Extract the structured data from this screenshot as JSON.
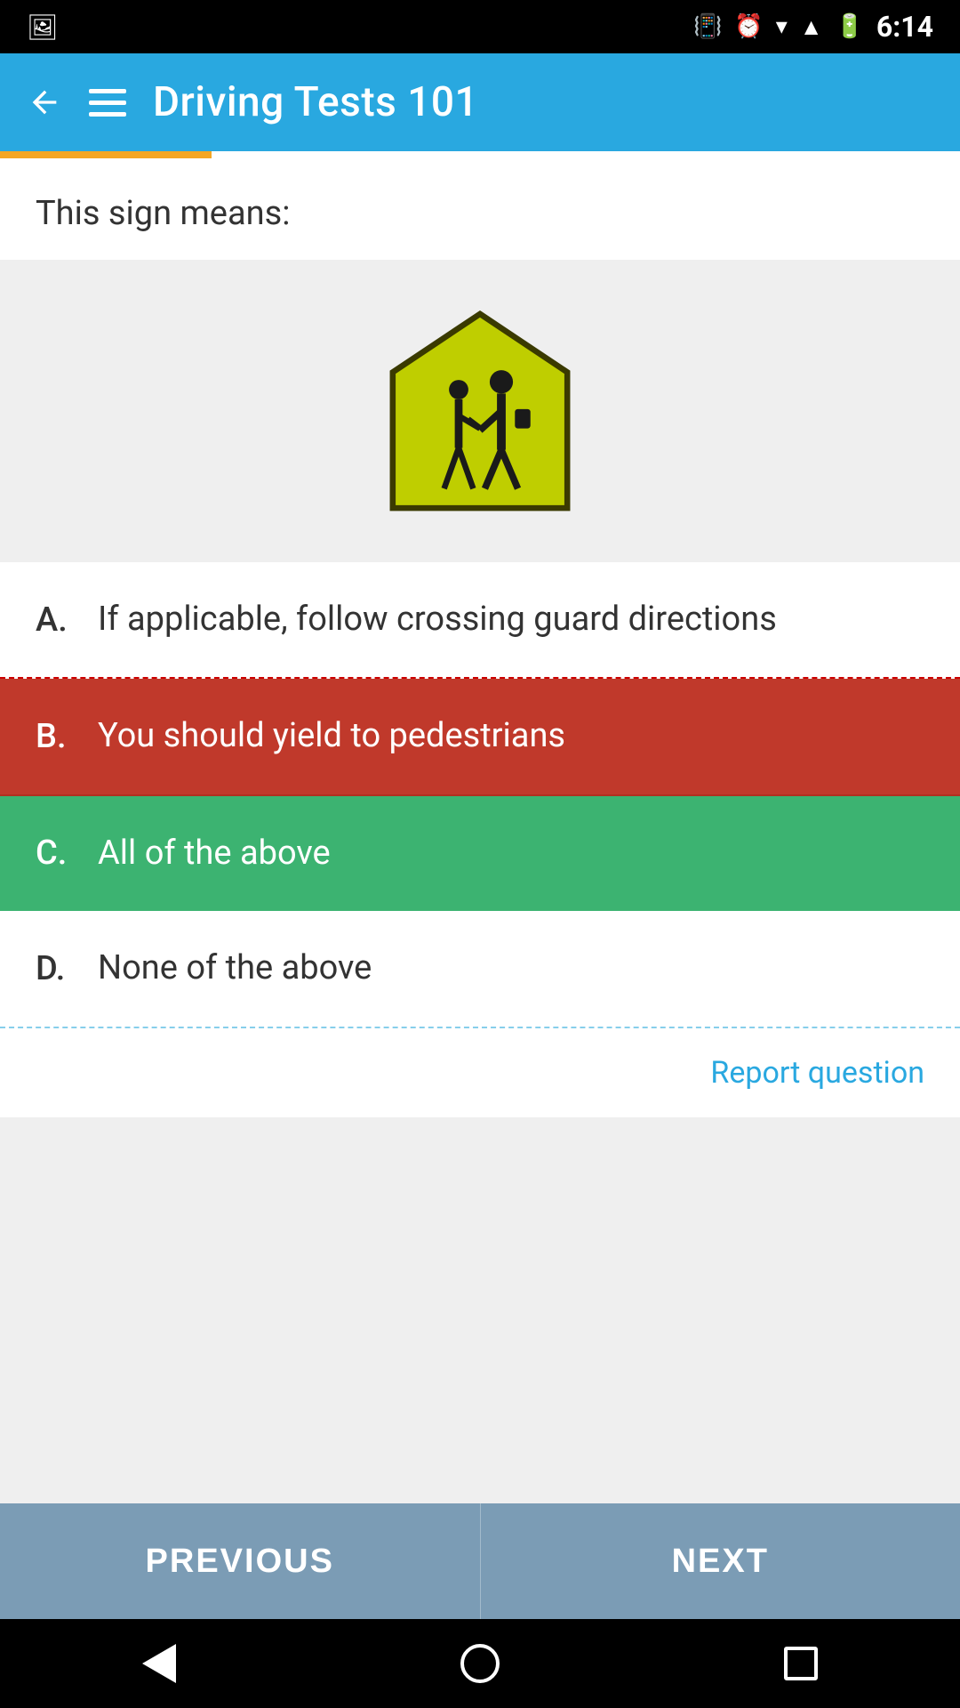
{
  "app": {
    "title": "Driving Tests 101",
    "time": "6:14"
  },
  "question": {
    "label": "This sign means:",
    "sign_description": "School crossing sign - pentagon shaped yellow-green sign with two pedestrian figures"
  },
  "answers": [
    {
      "letter": "A.",
      "text": "If applicable, follow crossing guard directions",
      "state": "normal",
      "id": "answer-a"
    },
    {
      "letter": "B.",
      "text": "You should yield to pedestrians",
      "state": "incorrect",
      "id": "answer-b"
    },
    {
      "letter": "C.",
      "text": "All of the above",
      "state": "correct",
      "id": "answer-c"
    },
    {
      "letter": "D.",
      "text": "None of the above",
      "state": "normal",
      "id": "answer-d"
    }
  ],
  "report_link": "Report question",
  "navigation": {
    "previous": "PREVIOUS",
    "next": "NEXT"
  },
  "progress": {
    "percent": 22
  }
}
